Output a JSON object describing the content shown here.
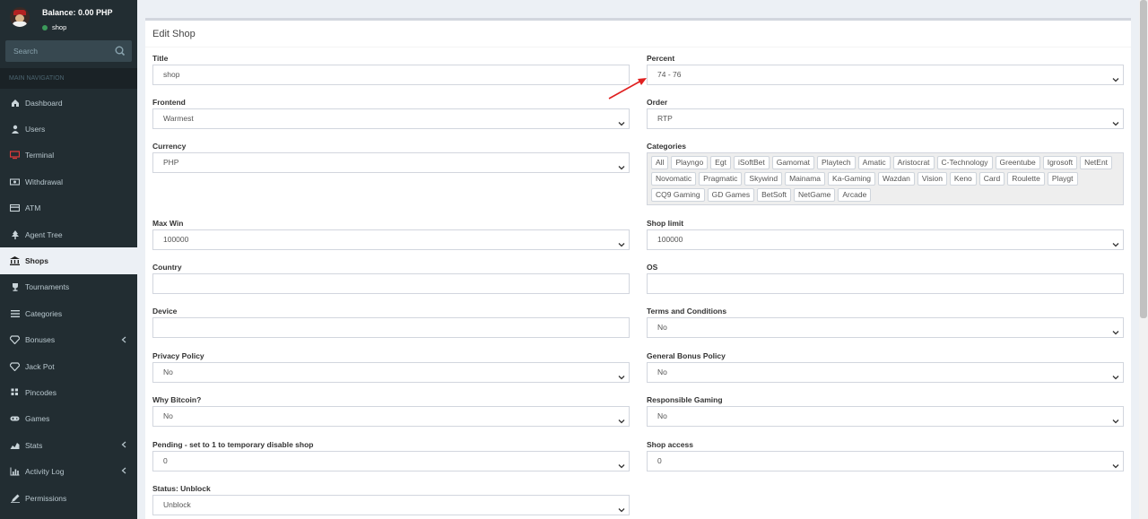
{
  "user": {
    "balance": "Balance: 0.00 PHP",
    "status": "shop",
    "status_color": "#3c9a5b"
  },
  "search": {
    "placeholder": "Search"
  },
  "nav_header": "MAIN NAVIGATION",
  "menu": [
    {
      "label": "Dashboard",
      "icon": "dashboard-icon",
      "active": false,
      "has_children": false
    },
    {
      "label": "Users",
      "icon": "user-icon",
      "active": false,
      "has_children": false
    },
    {
      "label": "Terminal",
      "icon": "monitor-icon",
      "active": false,
      "has_children": false
    },
    {
      "label": "Withdrawal",
      "icon": "money-icon",
      "active": false,
      "has_children": false
    },
    {
      "label": "ATM",
      "icon": "credit-card-icon",
      "active": false,
      "has_children": false
    },
    {
      "label": "Agent Tree",
      "icon": "tree-icon",
      "active": false,
      "has_children": false
    },
    {
      "label": "Shops",
      "icon": "bank-icon",
      "active": true,
      "has_children": false
    },
    {
      "label": "Tournaments",
      "icon": "trophy-icon",
      "active": false,
      "has_children": false
    },
    {
      "label": "Categories",
      "icon": "list-icon",
      "active": false,
      "has_children": false
    },
    {
      "label": "Bonuses",
      "icon": "diamond-icon",
      "active": false,
      "has_children": true
    },
    {
      "label": "Jack Pot",
      "icon": "diamond-icon",
      "active": false,
      "has_children": false
    },
    {
      "label": "Pincodes",
      "icon": "grid-icon",
      "active": false,
      "has_children": false
    },
    {
      "label": "Games",
      "icon": "gamepad-icon",
      "active": false,
      "has_children": false
    },
    {
      "label": "Stats",
      "icon": "chart-icon",
      "active": false,
      "has_children": true
    },
    {
      "label": "Activity Log",
      "icon": "bar-chart-icon",
      "active": false,
      "has_children": true
    },
    {
      "label": "Permissions",
      "icon": "pen-icon",
      "active": false,
      "has_children": false
    }
  ],
  "page": {
    "title": "Edit Shop"
  },
  "fields": {
    "title": {
      "label": "Title",
      "value": "shop"
    },
    "percent": {
      "label": "Percent",
      "value": "74 - 76"
    },
    "frontend": {
      "label": "Frontend",
      "value": "Warmest"
    },
    "order": {
      "label": "Order",
      "value": "RTP"
    },
    "currency": {
      "label": "Currency",
      "value": "PHP"
    },
    "categories": {
      "label": "Categories"
    },
    "max_win": {
      "label": "Max Win",
      "value": "100000"
    },
    "shop_limit": {
      "label": "Shop limit",
      "value": "100000"
    },
    "country": {
      "label": "Country",
      "value": ""
    },
    "os": {
      "label": "OS",
      "value": ""
    },
    "device": {
      "label": "Device",
      "value": ""
    },
    "terms": {
      "label": "Terms and Conditions",
      "value": "No"
    },
    "privacy": {
      "label": "Privacy Policy",
      "value": "No"
    },
    "bonus_policy": {
      "label": "General Bonus Policy",
      "value": "No"
    },
    "why_bitcoin": {
      "label": "Why Bitcoin?",
      "value": "No"
    },
    "responsible": {
      "label": "Responsible Gaming",
      "value": "No"
    },
    "pending": {
      "label": "Pending - set to 1 to temporary disable shop",
      "value": "0"
    },
    "shop_access": {
      "label": "Shop access",
      "value": "0"
    },
    "status": {
      "label": "Status: Unblock",
      "value": "Unblock"
    }
  },
  "categories": [
    "All",
    "Playngo",
    "Egt",
    "iSoftBet",
    "Gamomat",
    "Playtech",
    "Amatic",
    "Aristocrat",
    "C-Technology",
    "Greentube",
    "Igrosoft",
    "NetEnt",
    "Novomatic",
    "Pragmatic",
    "Skywind",
    "Mainama",
    "Ka-Gaming",
    "Wazdan",
    "Vision",
    "Keno",
    "Card",
    "Roulette",
    "Playgt",
    "CQ9 Gaming",
    "GD Games",
    "BetSoft",
    "NetGame",
    "Arcade"
  ],
  "colors": {
    "sidebar": "#222d32",
    "content_bg": "#ecf0f5",
    "annotation_arrow": "#e02020"
  }
}
